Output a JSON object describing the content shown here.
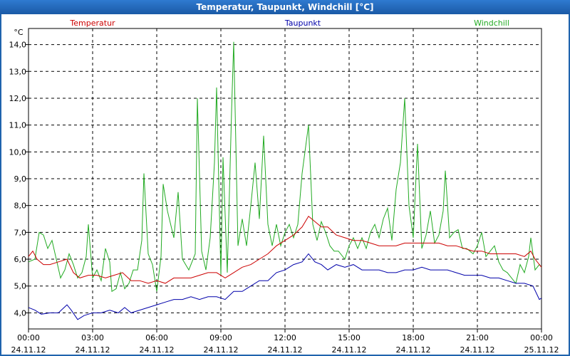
{
  "window": {
    "title": "Temperatur, Taupunkt, Windchill [°C]"
  },
  "chart_data": {
    "type": "line",
    "ylabel": "°C",
    "ylim": [
      3.4,
      14.6
    ],
    "yticks": [
      4.0,
      5.0,
      6.0,
      7.0,
      8.0,
      9.0,
      10.0,
      11.0,
      12.0,
      13.0,
      14.0
    ],
    "ytick_labels": [
      "4,0",
      "5,0",
      "6,0",
      "7,0",
      "8,0",
      "9,0",
      "10,0",
      "11,0",
      "12,0",
      "13,0",
      "14,0"
    ],
    "xlim": [
      0,
      24
    ],
    "xticks": [
      {
        "hour": 0,
        "time": "00:00",
        "date": "24.11.12"
      },
      {
        "hour": 3,
        "time": "03:00",
        "date": "24.11.12"
      },
      {
        "hour": 6,
        "time": "06:00",
        "date": "24.11.12"
      },
      {
        "hour": 9,
        "time": "09:00",
        "date": "24.11.12"
      },
      {
        "hour": 12,
        "time": "12:00",
        "date": "24.11.12"
      },
      {
        "hour": 15,
        "time": "15:00",
        "date": "24.11.12"
      },
      {
        "hour": 18,
        "time": "18:00",
        "date": "24.11.12"
      },
      {
        "hour": 21,
        "time": "21:00",
        "date": "24.11.12"
      },
      {
        "hour": 24,
        "time": "00:00",
        "date": "25.11.12"
      }
    ],
    "grid": true,
    "legend_position": "top",
    "series": [
      {
        "name": "Temperatur",
        "color": "#cc0000",
        "points": [
          [
            0.0,
            6.1
          ],
          [
            0.2,
            6.3
          ],
          [
            0.4,
            6.0
          ],
          [
            0.7,
            5.8
          ],
          [
            1.0,
            5.8
          ],
          [
            1.4,
            5.9
          ],
          [
            1.8,
            6.0
          ],
          [
            2.1,
            5.5
          ],
          [
            2.4,
            5.3
          ],
          [
            2.8,
            5.4
          ],
          [
            3.2,
            5.4
          ],
          [
            3.6,
            5.3
          ],
          [
            4.0,
            5.4
          ],
          [
            4.4,
            5.5
          ],
          [
            4.8,
            5.2
          ],
          [
            5.2,
            5.2
          ],
          [
            5.6,
            5.1
          ],
          [
            6.0,
            5.2
          ],
          [
            6.4,
            5.1
          ],
          [
            6.8,
            5.3
          ],
          [
            7.2,
            5.3
          ],
          [
            7.6,
            5.3
          ],
          [
            8.0,
            5.4
          ],
          [
            8.4,
            5.5
          ],
          [
            8.8,
            5.5
          ],
          [
            9.2,
            5.3
          ],
          [
            9.6,
            5.5
          ],
          [
            10.0,
            5.7
          ],
          [
            10.4,
            5.8
          ],
          [
            10.8,
            6.0
          ],
          [
            11.2,
            6.2
          ],
          [
            11.6,
            6.5
          ],
          [
            12.0,
            6.7
          ],
          [
            12.4,
            6.9
          ],
          [
            12.8,
            7.2
          ],
          [
            13.1,
            7.6
          ],
          [
            13.4,
            7.4
          ],
          [
            13.7,
            7.2
          ],
          [
            14.0,
            7.2
          ],
          [
            14.4,
            6.9
          ],
          [
            14.8,
            6.8
          ],
          [
            15.2,
            6.7
          ],
          [
            15.6,
            6.7
          ],
          [
            16.0,
            6.6
          ],
          [
            16.4,
            6.5
          ],
          [
            16.8,
            6.5
          ],
          [
            17.2,
            6.5
          ],
          [
            17.6,
            6.6
          ],
          [
            18.0,
            6.6
          ],
          [
            18.4,
            6.6
          ],
          [
            18.8,
            6.6
          ],
          [
            19.2,
            6.6
          ],
          [
            19.6,
            6.5
          ],
          [
            20.0,
            6.5
          ],
          [
            20.4,
            6.4
          ],
          [
            20.8,
            6.3
          ],
          [
            21.2,
            6.3
          ],
          [
            21.6,
            6.2
          ],
          [
            22.0,
            6.2
          ],
          [
            22.4,
            6.2
          ],
          [
            22.8,
            6.2
          ],
          [
            23.2,
            6.1
          ],
          [
            23.5,
            6.3
          ],
          [
            23.7,
            6.0
          ],
          [
            24.0,
            5.7
          ]
        ]
      },
      {
        "name": "Taupunkt",
        "color": "#0000aa",
        "points": [
          [
            0.0,
            4.2
          ],
          [
            0.3,
            4.1
          ],
          [
            0.6,
            3.95
          ],
          [
            1.0,
            4.0
          ],
          [
            1.4,
            4.0
          ],
          [
            1.8,
            4.3
          ],
          [
            2.0,
            4.1
          ],
          [
            2.3,
            3.75
          ],
          [
            2.6,
            3.9
          ],
          [
            3.0,
            4.0
          ],
          [
            3.4,
            4.0
          ],
          [
            3.8,
            4.1
          ],
          [
            4.2,
            4.0
          ],
          [
            4.5,
            4.2
          ],
          [
            4.8,
            4.0
          ],
          [
            5.2,
            4.1
          ],
          [
            5.6,
            4.2
          ],
          [
            6.0,
            4.3
          ],
          [
            6.4,
            4.4
          ],
          [
            6.8,
            4.5
          ],
          [
            7.2,
            4.5
          ],
          [
            7.6,
            4.6
          ],
          [
            8.0,
            4.5
          ],
          [
            8.4,
            4.6
          ],
          [
            8.8,
            4.6
          ],
          [
            9.2,
            4.5
          ],
          [
            9.6,
            4.8
          ],
          [
            10.0,
            4.8
          ],
          [
            10.4,
            5.0
          ],
          [
            10.8,
            5.2
          ],
          [
            11.2,
            5.2
          ],
          [
            11.6,
            5.5
          ],
          [
            12.0,
            5.6
          ],
          [
            12.4,
            5.8
          ],
          [
            12.8,
            5.9
          ],
          [
            13.1,
            6.2
          ],
          [
            13.4,
            5.9
          ],
          [
            13.7,
            5.8
          ],
          [
            14.0,
            5.6
          ],
          [
            14.4,
            5.8
          ],
          [
            14.8,
            5.7
          ],
          [
            15.2,
            5.8
          ],
          [
            15.6,
            5.6
          ],
          [
            16.0,
            5.6
          ],
          [
            16.4,
            5.6
          ],
          [
            16.8,
            5.5
          ],
          [
            17.2,
            5.5
          ],
          [
            17.6,
            5.6
          ],
          [
            18.0,
            5.6
          ],
          [
            18.4,
            5.7
          ],
          [
            18.8,
            5.6
          ],
          [
            19.2,
            5.6
          ],
          [
            19.6,
            5.6
          ],
          [
            20.0,
            5.5
          ],
          [
            20.4,
            5.4
          ],
          [
            20.8,
            5.4
          ],
          [
            21.2,
            5.4
          ],
          [
            21.6,
            5.3
          ],
          [
            22.0,
            5.3
          ],
          [
            22.4,
            5.2
          ],
          [
            22.8,
            5.1
          ],
          [
            23.2,
            5.1
          ],
          [
            23.6,
            5.0
          ],
          [
            23.9,
            4.5
          ],
          [
            24.0,
            4.55
          ]
        ]
      },
      {
        "name": "Windchill",
        "color": "#22aa22",
        "points": [
          [
            0.0,
            5.9
          ],
          [
            0.3,
            6.0
          ],
          [
            0.5,
            7.0
          ],
          [
            0.7,
            6.9
          ],
          [
            0.9,
            6.4
          ],
          [
            1.1,
            6.7
          ],
          [
            1.3,
            6.0
          ],
          [
            1.5,
            5.3
          ],
          [
            1.7,
            5.6
          ],
          [
            1.9,
            6.2
          ],
          [
            2.1,
            5.8
          ],
          [
            2.3,
            5.3
          ],
          [
            2.5,
            5.5
          ],
          [
            2.7,
            6.1
          ],
          [
            2.8,
            7.3
          ],
          [
            3.0,
            5.3
          ],
          [
            3.2,
            5.6
          ],
          [
            3.4,
            5.2
          ],
          [
            3.6,
            6.4
          ],
          [
            3.8,
            5.9
          ],
          [
            3.9,
            4.8
          ],
          [
            4.1,
            4.9
          ],
          [
            4.3,
            5.5
          ],
          [
            4.5,
            4.9
          ],
          [
            4.7,
            5.1
          ],
          [
            4.9,
            5.6
          ],
          [
            5.1,
            5.6
          ],
          [
            5.3,
            6.7
          ],
          [
            5.4,
            9.2
          ],
          [
            5.6,
            6.2
          ],
          [
            5.8,
            5.8
          ],
          [
            6.0,
            4.8
          ],
          [
            6.2,
            6.1
          ],
          [
            6.3,
            8.8
          ],
          [
            6.5,
            7.8
          ],
          [
            6.8,
            6.8
          ],
          [
            7.0,
            8.5
          ],
          [
            7.2,
            6.0
          ],
          [
            7.5,
            5.6
          ],
          [
            7.8,
            6.2
          ],
          [
            7.9,
            12.0
          ],
          [
            8.1,
            6.3
          ],
          [
            8.3,
            5.6
          ],
          [
            8.5,
            6.8
          ],
          [
            8.7,
            9.6
          ],
          [
            8.8,
            12.4
          ],
          [
            9.0,
            5.4
          ],
          [
            9.1,
            9.8
          ],
          [
            9.3,
            5.5
          ],
          [
            9.5,
            11.5
          ],
          [
            9.6,
            14.1
          ],
          [
            9.8,
            6.5
          ],
          [
            10.0,
            7.5
          ],
          [
            10.2,
            6.5
          ],
          [
            10.4,
            8.0
          ],
          [
            10.6,
            9.6
          ],
          [
            10.8,
            7.5
          ],
          [
            11.0,
            10.6
          ],
          [
            11.2,
            7.3
          ],
          [
            11.4,
            6.5
          ],
          [
            11.6,
            7.3
          ],
          [
            11.8,
            6.5
          ],
          [
            12.0,
            7.0
          ],
          [
            12.2,
            7.3
          ],
          [
            12.4,
            6.8
          ],
          [
            12.6,
            7.3
          ],
          [
            12.8,
            9.2
          ],
          [
            13.1,
            11.0
          ],
          [
            13.3,
            7.3
          ],
          [
            13.5,
            6.7
          ],
          [
            13.7,
            7.4
          ],
          [
            13.9,
            7.0
          ],
          [
            14.1,
            6.5
          ],
          [
            14.3,
            6.3
          ],
          [
            14.5,
            6.3
          ],
          [
            14.8,
            6.0
          ],
          [
            15.0,
            6.5
          ],
          [
            15.2,
            6.8
          ],
          [
            15.4,
            6.4
          ],
          [
            15.6,
            6.8
          ],
          [
            15.8,
            6.4
          ],
          [
            16.0,
            7.0
          ],
          [
            16.2,
            7.3
          ],
          [
            16.4,
            6.8
          ],
          [
            16.6,
            7.5
          ],
          [
            16.8,
            7.9
          ],
          [
            17.0,
            6.7
          ],
          [
            17.2,
            8.6
          ],
          [
            17.4,
            9.6
          ],
          [
            17.6,
            12.0
          ],
          [
            17.8,
            8.0
          ],
          [
            18.0,
            6.8
          ],
          [
            18.2,
            10.3
          ],
          [
            18.4,
            6.4
          ],
          [
            18.6,
            6.9
          ],
          [
            18.8,
            7.8
          ],
          [
            19.0,
            6.6
          ],
          [
            19.2,
            6.9
          ],
          [
            19.4,
            7.8
          ],
          [
            19.5,
            9.3
          ],
          [
            19.7,
            6.8
          ],
          [
            19.9,
            7.0
          ],
          [
            20.1,
            7.1
          ],
          [
            20.3,
            6.4
          ],
          [
            20.5,
            6.4
          ],
          [
            20.8,
            6.2
          ],
          [
            21.0,
            6.5
          ],
          [
            21.2,
            7.0
          ],
          [
            21.4,
            6.1
          ],
          [
            21.6,
            6.3
          ],
          [
            21.8,
            6.5
          ],
          [
            22.0,
            5.9
          ],
          [
            22.2,
            5.6
          ],
          [
            22.4,
            5.5
          ],
          [
            22.6,
            5.3
          ],
          [
            22.8,
            5.1
          ],
          [
            23.0,
            5.8
          ],
          [
            23.2,
            5.5
          ],
          [
            23.4,
            6.1
          ],
          [
            23.5,
            6.8
          ],
          [
            23.7,
            5.6
          ],
          [
            23.9,
            5.8
          ],
          [
            24.0,
            5.7
          ]
        ]
      }
    ]
  }
}
